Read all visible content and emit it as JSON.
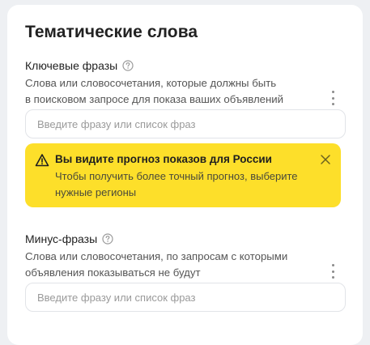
{
  "section": {
    "title": "Тематические слова"
  },
  "keywords": {
    "label": "Ключевые фразы",
    "help_icon": "question-circle-icon",
    "description_line1": "Слова или словосочетания, которые должны быть",
    "description_line2": "в поисковом запросе для показа ваших объявлений",
    "input_placeholder": "Введите фразу или список фраз",
    "input_value": ""
  },
  "alert": {
    "icon": "warning-triangle-icon",
    "title": "Вы видите прогноз показов для России",
    "text_line1": "Чтобы получить более точный прогноз, выберите",
    "text_line2": "нужные регионы",
    "close_icon": "close-icon",
    "background": "#fddf2a"
  },
  "minus": {
    "label": "Минус-фразы",
    "help_icon": "question-circle-icon",
    "description_line1": "Слова или словосочетания, по запросам с которыми",
    "description_line2": "объявления показываться не будут",
    "input_placeholder": "Введите фразу или список фраз",
    "input_value": ""
  }
}
